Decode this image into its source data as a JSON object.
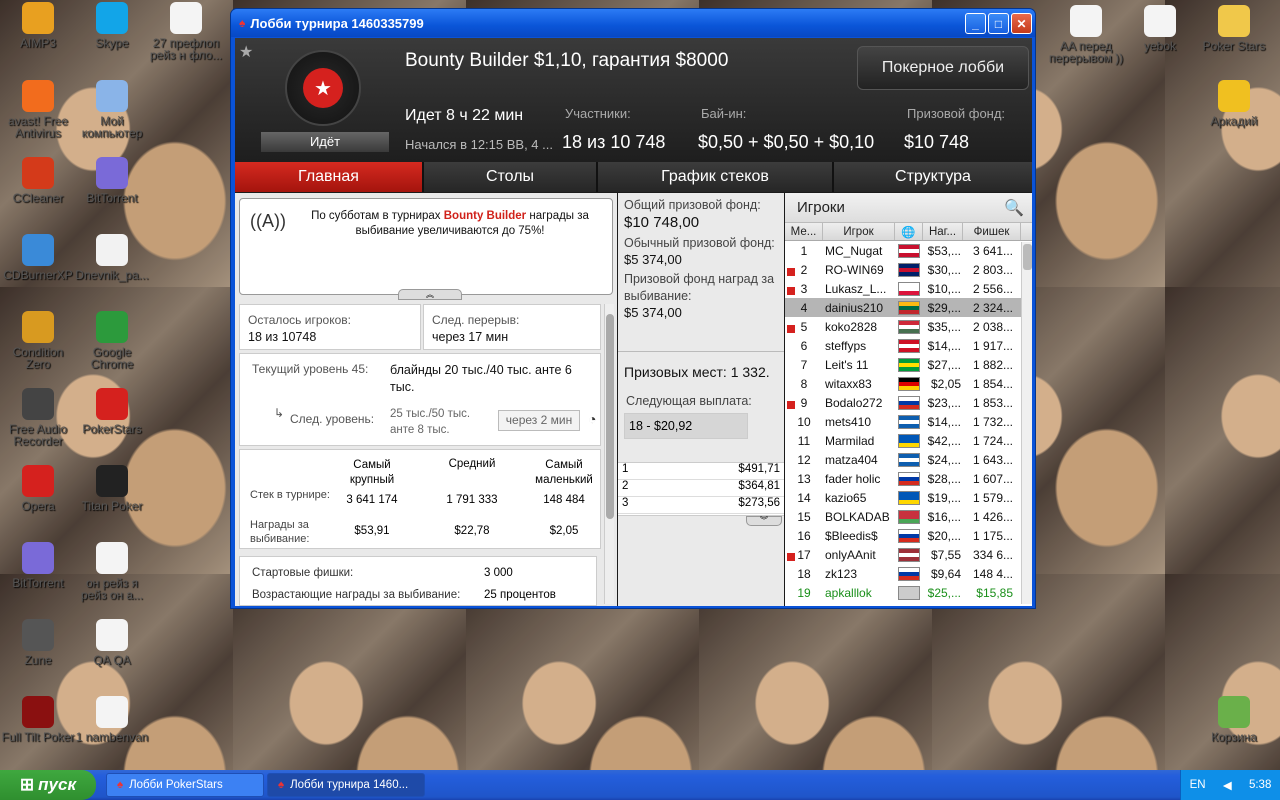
{
  "desktop": {
    "icons": [
      {
        "label": "AIMP3",
        "icon": "aimp-icon",
        "color": "#e8a020"
      },
      {
        "label": "Skype",
        "icon": "skype-icon",
        "color": "#12a5e8"
      },
      {
        "label": "27 префлоп рейз н фло...",
        "icon": "document-icon",
        "color": "#f4f4f4"
      },
      {
        "label": "avast! Free Antivirus",
        "icon": "avast-icon",
        "color": "#f26c1d"
      },
      {
        "label": "Мой компьютер",
        "icon": "computer-icon",
        "color": "#8ab4e8"
      },
      {
        "label": "CCleaner",
        "icon": "ccleaner-icon",
        "color": "#d43a1a"
      },
      {
        "label": "BitTorrent",
        "icon": "bittorrent-icon",
        "color": "#7a6ad8"
      },
      {
        "label": "CDBurnerXP",
        "icon": "cd-icon",
        "color": "#3a8ad8"
      },
      {
        "label": "Dnevnik_pa...",
        "icon": "media-icon",
        "color": "#f2f2f2"
      },
      {
        "label": "Condition Zero",
        "icon": "cs-icon",
        "color": "#d89a20"
      },
      {
        "label": "Google Chrome",
        "icon": "chrome-icon",
        "color": "#2c9a3c"
      },
      {
        "label": "Free Audio Recorder",
        "icon": "mic-icon",
        "color": "#444"
      },
      {
        "label": "PokerStars",
        "icon": "pokerstars-icon",
        "color": "#d5211e"
      },
      {
        "label": "Opera",
        "icon": "opera-icon",
        "color": "#d5211e"
      },
      {
        "label": "Titan Poker",
        "icon": "titan-icon",
        "color": "#222"
      },
      {
        "label": "BitTorrent",
        "icon": "bittorrent-icon",
        "color": "#7a6ad8"
      },
      {
        "label": "он рейз я рейз он а...",
        "icon": "document-icon",
        "color": "#f4f4f4"
      },
      {
        "label": "Zune",
        "icon": "zune-icon",
        "color": "#555"
      },
      {
        "label": "QA QA",
        "icon": "document-icon",
        "color": "#f4f4f4"
      },
      {
        "label": "Full Tilt Poker",
        "icon": "fulltilt-icon",
        "color": "#8a1010"
      },
      {
        "label": "1 nambenvan",
        "icon": "document-icon",
        "color": "#f4f4f4"
      },
      {
        "label": "AA перед перерывом ))",
        "icon": "document-icon",
        "color": "#f4f4f4"
      },
      {
        "label": "yebok",
        "icon": "document-icon",
        "color": "#f4f4f4"
      },
      {
        "label": "Poker Stars",
        "icon": "folder-icon",
        "color": "#f0c84a"
      },
      {
        "label": "Аркадий",
        "icon": "star-icon",
        "color": "#f0c020"
      },
      {
        "label": "Корзина",
        "icon": "recycle-bin-icon",
        "color": "#6ab04a"
      }
    ]
  },
  "window": {
    "title": "Лобби турнира 1460335799",
    "min": "_",
    "max": "□",
    "close": "✕"
  },
  "header": {
    "title": "Bounty Builder $1,10, гарантия $8000",
    "status": "Идёт",
    "lobby_button": "Покерное лобби",
    "running": "Идет 8 ч 22 мин",
    "started": "Начался в 12:15 ВВ, 4 ...",
    "participants_label": "Участники:",
    "participants_value": "18 из 10 748",
    "buyin_label": "Бай-ин:",
    "buyin_value": "$0,50 + $0,50 + $0,10",
    "prize_label": "Призовой фонд:",
    "prize_value": "$10 748"
  },
  "tabs": [
    "Главная",
    "Столы",
    "График стеков",
    "Структура"
  ],
  "announce": {
    "pre": "По субботам в турнирах ",
    "highlight": "Bounty Builder",
    "post": " награды за выбивание увеличиваются до 75%!"
  },
  "info": {
    "players_left_label": "Осталось игроков:",
    "players_left_value": "18 из 10748",
    "next_break_label": "След. перерыв:",
    "next_break_value": "через 17 мин",
    "level_label": "Текущий уровень 45:",
    "level_value": "блайнды 20 тыс./40 тыс. анте 6 тыс.",
    "next_level_label": "След. уровень:",
    "next_level_value": "25 тыс./50 тыс. анте 8 тыс.",
    "next_level_time": "через 2 мин",
    "col_largest": "Самый крупный",
    "col_average": "Средний",
    "col_smallest": "Самый маленький",
    "row_stack": "Стек в турнире:",
    "row_bounty": "Награды за выбивание:",
    "stack_largest": "3 641 174",
    "stack_average": "1 791 333",
    "stack_smallest": "148 484",
    "bounty_largest": "$53,91",
    "bounty_average": "$22,78",
    "bounty_smallest": "$2,05",
    "starting_chips_label": "Стартовые фишки:",
    "starting_chips_value": "3 000",
    "next_row_label": "Возрастающие награды за выбивание:",
    "next_row_value": "25 процентов"
  },
  "prizes": {
    "total_label": "Общий призовой фонд:",
    "total_value": "$10 748,00",
    "regular_label": "Обычный призовой фонд:",
    "regular_value": "$5 374,00",
    "bounty_label": "Призовой фонд наград за выбивание:",
    "bounty_value": "$5 374,00",
    "places": "Призовых мест: 1 332.",
    "next_payout_label": "Следующая выплата:",
    "next_payout_value": "18 - $20,92",
    "payouts": [
      {
        "place": "1",
        "amount": "$491,71"
      },
      {
        "place": "2",
        "amount": "$364,81"
      },
      {
        "place": "3",
        "amount": "$273,56"
      }
    ]
  },
  "players": {
    "header": "Игроки",
    "columns": [
      "Ме...",
      "Игрок",
      "",
      "Наг...",
      "Фишек"
    ],
    "rows": [
      {
        "rank": "1",
        "name": "MC_Nugat",
        "bounty": "$53,...",
        "chips": "3 641...",
        "flag": [
          "#c8102e",
          "#fff",
          "#c8102e"
        ],
        "mark": false
      },
      {
        "rank": "2",
        "name": "RO-WIN69",
        "bounty": "$30,...",
        "chips": "2 803...",
        "flag": [
          "#012169",
          "#c8102e",
          "#012169"
        ],
        "mark": true
      },
      {
        "rank": "3",
        "name": "Lukasz_L...",
        "bounty": "$10,...",
        "chips": "2 556...",
        "flag": [
          "#fff",
          "#fff",
          "#dc143c"
        ],
        "mark": true
      },
      {
        "rank": "4",
        "name": "dainius210",
        "bounty": "$29,...",
        "chips": "2 324...",
        "flag": [
          "#fdb913",
          "#006a44",
          "#c1272d"
        ],
        "mark": false,
        "sel": true
      },
      {
        "rank": "5",
        "name": "koko2828",
        "bounty": "$35,...",
        "chips": "2 038...",
        "flag": [
          "#ce2939",
          "#fff",
          "#477050"
        ],
        "mark": true
      },
      {
        "rank": "6",
        "name": "steffyps",
        "bounty": "$14,...",
        "chips": "1 917...",
        "flag": [
          "#ce1126",
          "#fff",
          "#ce1126"
        ],
        "mark": false
      },
      {
        "rank": "7",
        "name": "Leit's 11",
        "bounty": "$27,...",
        "chips": "1 882...",
        "flag": [
          "#009c3b",
          "#ffdf00",
          "#009c3b"
        ],
        "mark": false
      },
      {
        "rank": "8",
        "name": "witaxx83",
        "bounty": "$2,05",
        "chips": "1 854...",
        "flag": [
          "#000",
          "#dd0000",
          "#ffce00"
        ],
        "mark": false
      },
      {
        "rank": "9",
        "name": "Bodalo272",
        "bounty": "$23,...",
        "chips": "1 853...",
        "flag": [
          "#fff",
          "#0039a6",
          "#d52b1e"
        ],
        "mark": true
      },
      {
        "rank": "10",
        "name": "mets410",
        "bounty": "$14,...",
        "chips": "1 732...",
        "flag": [
          "#0d5eaf",
          "#fff",
          "#0d5eaf"
        ],
        "mark": false
      },
      {
        "rank": "11",
        "name": "Marmilad",
        "bounty": "$42,...",
        "chips": "1 724...",
        "flag": [
          "#0057b7",
          "#0057b7",
          "#ffd700"
        ],
        "mark": false
      },
      {
        "rank": "12",
        "name": "matza404",
        "bounty": "$24,...",
        "chips": "1 643...",
        "flag": [
          "#0d5eaf",
          "#fff",
          "#0d5eaf"
        ],
        "mark": false
      },
      {
        "rank": "13",
        "name": "fader holic",
        "bounty": "$28,...",
        "chips": "1 607...",
        "flag": [
          "#fff",
          "#0039a6",
          "#d52b1e"
        ],
        "mark": false
      },
      {
        "rank": "14",
        "name": "kazio65",
        "bounty": "$19,...",
        "chips": "1 579...",
        "flag": [
          "#0057b7",
          "#0057b7",
          "#ffd700"
        ],
        "mark": false
      },
      {
        "rank": "15",
        "name": "BOLKADAB",
        "bounty": "$16,...",
        "chips": "1 426...",
        "flag": [
          "#c8313e",
          "#c8313e",
          "#4aa657"
        ],
        "mark": false
      },
      {
        "rank": "16",
        "name": "$Bleedis$",
        "bounty": "$20,...",
        "chips": "1 175...",
        "flag": [
          "#fff",
          "#0039a6",
          "#d52b1e"
        ],
        "mark": false
      },
      {
        "rank": "17",
        "name": "onlyAAnit",
        "bounty": "$7,55",
        "chips": "334 6...",
        "flag": [
          "#9e3039",
          "#fff",
          "#9e3039"
        ],
        "mark": true
      },
      {
        "rank": "18",
        "name": "zk123",
        "bounty": "$9,64",
        "chips": "148 4...",
        "flag": [
          "#fff",
          "#0039a6",
          "#d52b1e"
        ],
        "mark": false
      },
      {
        "rank": "19",
        "name": "apkalllok",
        "bounty": "$25,...",
        "chips": "$15,85",
        "flag": [
          "#ccc",
          "#ccc",
          "#ccc"
        ],
        "mark": false,
        "me": true
      }
    ]
  },
  "taskbar": {
    "start": "пуск",
    "items": [
      "Лобби PokerStars",
      "Лобби турнира 1460..."
    ],
    "lang": "EN",
    "time": "5:38"
  }
}
